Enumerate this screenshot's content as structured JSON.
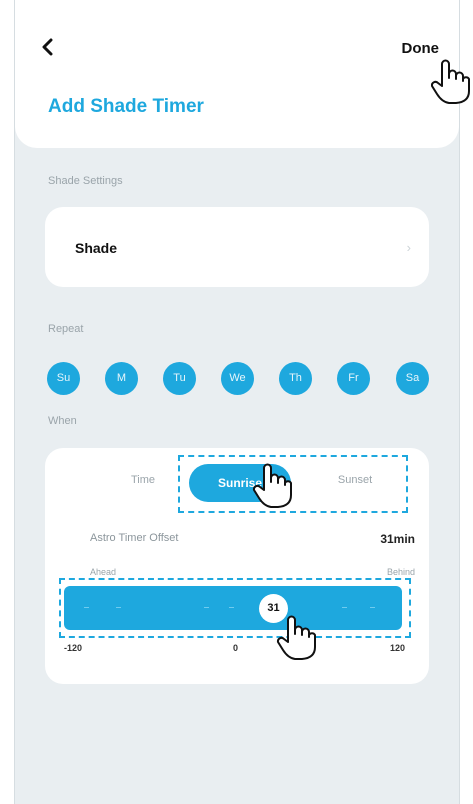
{
  "header": {
    "done_label": "Done",
    "title": "Add Shade Timer"
  },
  "shade_settings": {
    "section_label": "Shade Settings",
    "value": "Shade"
  },
  "repeat": {
    "section_label": "Repeat",
    "days": [
      "Su",
      "M",
      "Tu",
      "We",
      "Th",
      "Fr",
      "Sa"
    ]
  },
  "when": {
    "section_label": "When",
    "modes": [
      "Time",
      "Sunrise",
      "Sunset"
    ],
    "active_mode": "Sunrise",
    "offset_label": "Astro Timer Offset",
    "offset_value": "31min",
    "ahead_label": "Ahead",
    "behind_label": "Behind",
    "slider": {
      "value": "31",
      "min_label": "-120",
      "mid_label": "0",
      "max_label": "120"
    }
  },
  "colors": {
    "accent": "#1ea8de",
    "background": "#e9eef1"
  }
}
